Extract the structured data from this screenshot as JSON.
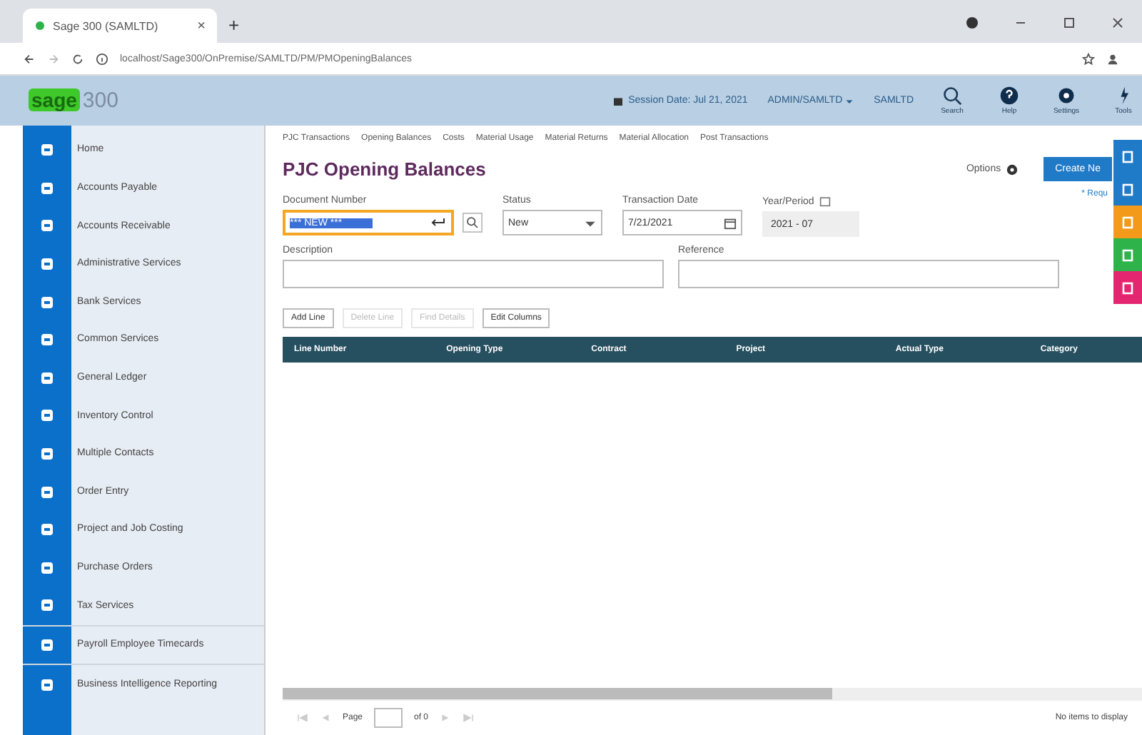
{
  "browser": {
    "tab_title": "Sage 300 (SAMLTD)",
    "close_glyph": "×",
    "new_tab_glyph": "+",
    "url": "localhost/Sage300/OnPremise/SAMLTD/PM/PMOpeningBalances"
  },
  "header": {
    "logo_word": "sage",
    "logo_number": "300",
    "session_date": "Session Date: Jul 21, 2021",
    "user": "ADMIN/SAMLTD",
    "company": "SAMLTD",
    "tools": [
      {
        "label": "Search",
        "kind": "search"
      },
      {
        "label": "Help",
        "kind": "help"
      },
      {
        "label": "Settings",
        "kind": "settings"
      },
      {
        "label": "Tools",
        "kind": "tools"
      }
    ]
  },
  "sidebar": {
    "items": [
      {
        "label": "Home"
      },
      {
        "label": "Accounts Payable"
      },
      {
        "label": "Accounts Receivable"
      },
      {
        "label": "Administrative Services"
      },
      {
        "label": "Bank Services"
      },
      {
        "label": "Common Services"
      },
      {
        "label": "General Ledger"
      },
      {
        "label": "Inventory Control"
      },
      {
        "label": "Multiple Contacts"
      },
      {
        "label": "Order Entry"
      },
      {
        "label": "Project and Job Costing"
      },
      {
        "label": "Purchase Orders"
      },
      {
        "label": "Tax Services"
      },
      {
        "label": "Payroll Employee Timecards"
      },
      {
        "label": "Business Intelligence Reporting"
      }
    ]
  },
  "breadcrumb": [
    {
      "label": "PJC Transactions"
    },
    {
      "label": "Opening Balances"
    },
    {
      "label": "Costs"
    },
    {
      "label": "Material Usage"
    },
    {
      "label": "Material Returns"
    },
    {
      "label": "Material Allocation"
    },
    {
      "label": "Post Transactions"
    }
  ],
  "page": {
    "title": "PJC Opening Balances",
    "options_label": "Options",
    "create_button": "Create Ne",
    "required_note": "* Requ"
  },
  "fields": {
    "document_number": {
      "label": "Document Number",
      "value": "*** NEW ***"
    },
    "status": {
      "label": "Status",
      "value": "New"
    },
    "transaction_date": {
      "label": "Transaction Date",
      "value": "7/21/2021"
    },
    "year_period": {
      "label": "Year/Period",
      "value": "2021 - 07"
    },
    "description": {
      "label": "Description"
    },
    "reference": {
      "label": "Reference"
    }
  },
  "toolbar": [
    {
      "label": "Add Line",
      "disabled": false
    },
    {
      "label": "Delete Line",
      "disabled": true
    },
    {
      "label": "Find Details",
      "disabled": true
    },
    {
      "label": "Edit Columns",
      "disabled": false
    }
  ],
  "table": {
    "columns": [
      "Line Number",
      "Opening Type",
      "Contract",
      "Project",
      "Actual Type",
      "Category"
    ]
  },
  "pager": {
    "page_label": "Page",
    "of_label": "of 0",
    "status": "No items to display"
  },
  "side_tabs": [
    {
      "color": "#1f7ac7"
    },
    {
      "color": "#1f7ac7"
    },
    {
      "color": "#f39a1b"
    },
    {
      "color": "#2db34a"
    },
    {
      "color": "#e3266f"
    }
  ]
}
